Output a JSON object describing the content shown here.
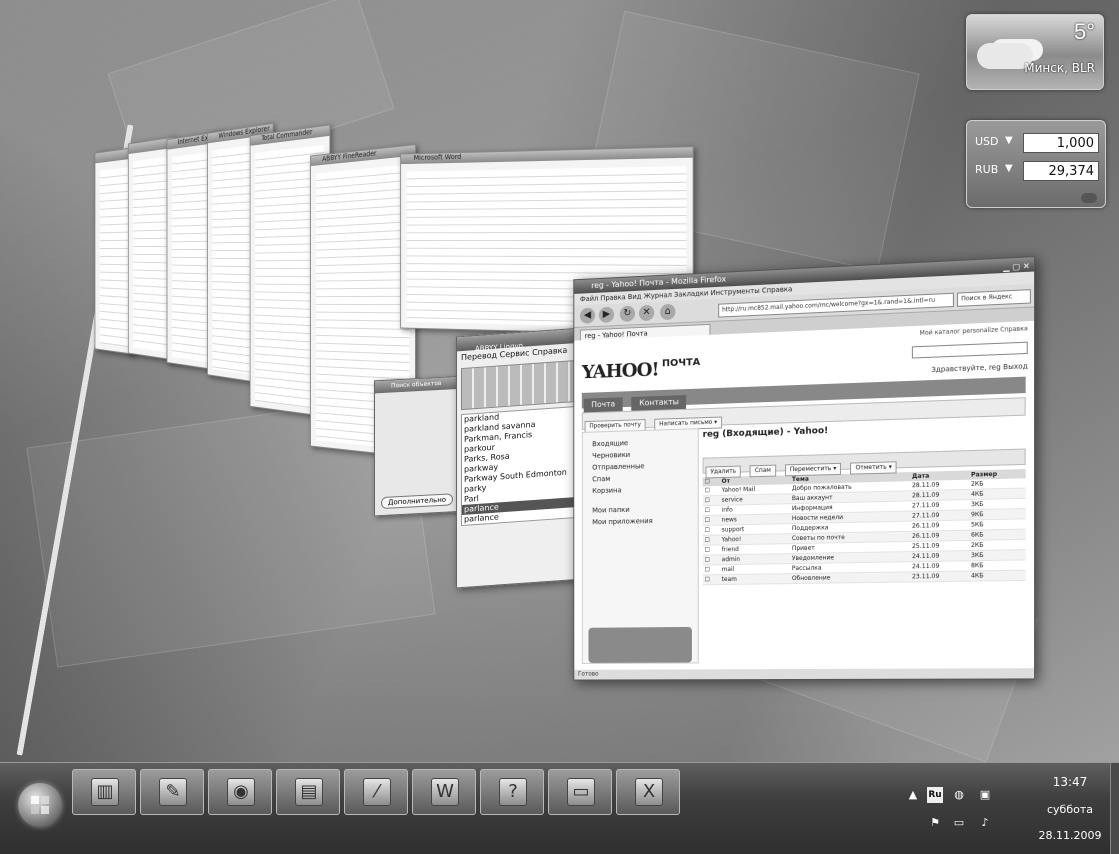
{
  "weather": {
    "temperature": "5°",
    "city": "Минск, BLR"
  },
  "currency": {
    "rows": [
      {
        "code": "USD",
        "value": "1,000"
      },
      {
        "code": "RUB",
        "value": "29,374"
      }
    ]
  },
  "browser": {
    "title": "reg - Yahoo! Почта - Mozilla Firefox",
    "menu": "Файл  Правка  Вид  Журнал  Закладки  Инструменты  Справка",
    "url": "http://ru.mc852.mail.yahoo.com/mc/welcome?gx=1&.rand=1&.intl=ru",
    "search_placeholder": "Поиск в Яндекс",
    "tab": "reg - Yahoo! Почта",
    "status": "Готово"
  },
  "yahoo": {
    "logo": "YAHOO!",
    "product": "ПОЧТА",
    "toplinks": "Мой каталог  personalize  Справка",
    "user": "Здравствуйте, reg  Выход",
    "tabs": [
      "Почта",
      "Контакты"
    ],
    "toolbar": [
      "Проверить почту",
      "Написать письмо ▾"
    ],
    "folders": [
      "Входящие",
      "Черновики",
      "Отправленные",
      "Спам",
      "Корзина",
      "Мои папки",
      "Мои приложения"
    ],
    "message_title": "reg (Входящие) - Yahoo!",
    "actions": [
      "Удалить",
      "Спам",
      "Переместить ▾",
      "Отметить ▾"
    ],
    "columns": [
      "От",
      "Тема",
      "Дата",
      "Размер"
    ],
    "messages": [
      {
        "from": "Yahoo! Mail",
        "subject": "Добро пожаловать",
        "date": "28.11.09",
        "size": "2КБ"
      },
      {
        "from": "service",
        "subject": "Ваш аккаунт",
        "date": "28.11.09",
        "size": "4КБ"
      },
      {
        "from": "info",
        "subject": "Информация",
        "date": "27.11.09",
        "size": "3КБ"
      },
      {
        "from": "news",
        "subject": "Новости недели",
        "date": "27.11.09",
        "size": "9КБ"
      },
      {
        "from": "support",
        "subject": "Поддержка",
        "date": "26.11.09",
        "size": "5КБ"
      },
      {
        "from": "Yahoo!",
        "subject": "Советы по почте",
        "date": "26.11.09",
        "size": "6КБ"
      },
      {
        "from": "friend",
        "subject": "Привет",
        "date": "25.11.09",
        "size": "2КБ"
      },
      {
        "from": "admin",
        "subject": "Уведомление",
        "date": "24.11.09",
        "size": "3КБ"
      },
      {
        "from": "mail",
        "subject": "Рассылка",
        "date": "24.11.09",
        "size": "8КБ"
      },
      {
        "from": "team",
        "subject": "Обновление",
        "date": "23.11.09",
        "size": "4КБ"
      }
    ]
  },
  "dictionary": {
    "title": "ABBYY Lingvo",
    "menu": "Перевод  Сервис  Справка",
    "words": [
      "parkland",
      "parkland savanna",
      "Parkman, Francis",
      "parkour",
      "Parks, Rosa",
      "parkway",
      "Parkway South Edmonton",
      "parky",
      "Parl",
      "parlance",
      "parlance"
    ]
  },
  "search_dialog": {
    "title": "Поиск объектов",
    "button": "Дополнительно"
  },
  "back_windows": [
    "Microsoft Word",
    "ABBYY FineReader",
    "Total Commander",
    "Windows Explorer",
    "Internet Explorer"
  ],
  "taskbar": {
    "buttons": [
      {
        "name": "notebook-icon",
        "glyph": "▥"
      },
      {
        "name": "paint-icon",
        "glyph": "✎"
      },
      {
        "name": "firefox-icon",
        "glyph": "◉"
      },
      {
        "name": "floppy-disk-icon",
        "glyph": "▤"
      },
      {
        "name": "scanner-icon",
        "glyph": "⁄"
      },
      {
        "name": "word-icon",
        "glyph": "W"
      },
      {
        "name": "help-icon",
        "glyph": "?"
      },
      {
        "name": "monitor-icon",
        "glyph": "▭"
      },
      {
        "name": "excel-icon",
        "glyph": "X"
      }
    ],
    "lang": "Ru"
  },
  "clock": {
    "time": "13:47",
    "day": "суббота",
    "date": "28.11.2009"
  }
}
